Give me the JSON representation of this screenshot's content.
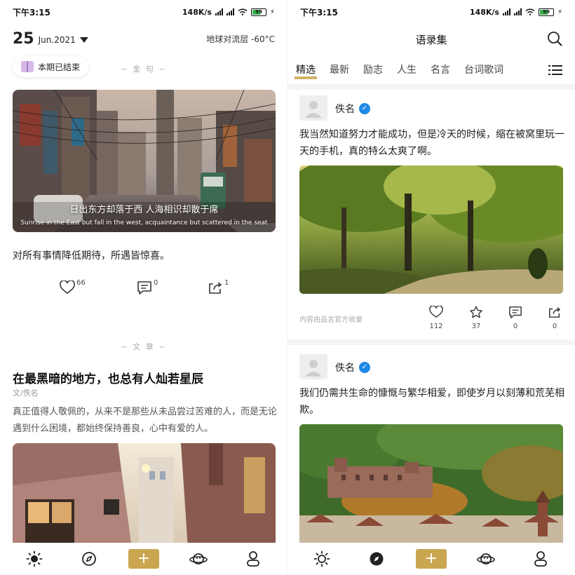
{
  "status": {
    "time": "下午3:15",
    "speed": "148K/s",
    "battery": "99"
  },
  "left": {
    "day": "25",
    "month": "Jun.2021",
    "weather": "地球对流层 -60°C",
    "ended_label": "本期已结束",
    "section_quote": "~ 金 句 ~",
    "hero_caption_cn": "日出东方却落于西 人海相识却散于席",
    "hero_caption_en": "Sunrise in the East but fall in the west, acquaintance but scattered in the seat",
    "quote": "对所有事情降低期待，所遇皆惊喜。",
    "likes": "66",
    "comments": "0",
    "shares": "1",
    "section_article": "~ 文 章 ~",
    "article_title": "在最黑暗的地方，也总有人灿若星辰",
    "article_author": "文/佚名",
    "article_excerpt": "真正值得人敬佩的，从来不是那些从未品尝过苦难的人，而是无论遇到什么困境，都始终保持善良，心中有爱的人。"
  },
  "right": {
    "title": "语录集",
    "tabs": [
      "精选",
      "最新",
      "励志",
      "人生",
      "名言",
      "台词歌词"
    ],
    "posts": [
      {
        "author": "佚名",
        "text": "我当然知道努力才能成功，但是冷天的时候，缩在被窝里玩一天的手机，真的特么太爽了啊。",
        "source": "内容由品言官方收录",
        "likes": "112",
        "favorites": "37",
        "comments": "0",
        "shares": "0"
      },
      {
        "author": "佚名",
        "text": "我们仍需共生命的慷慨与繁华相爱，即使岁月以刻薄和荒芜相欺。"
      }
    ]
  },
  "nav": {
    "items": [
      "sun-icon",
      "compass-icon",
      "add-icon",
      "planet-icon",
      "profile-icon"
    ],
    "add_label": "+"
  },
  "colors": {
    "accent": "#c9a64f",
    "verified": "#1e88e5"
  }
}
